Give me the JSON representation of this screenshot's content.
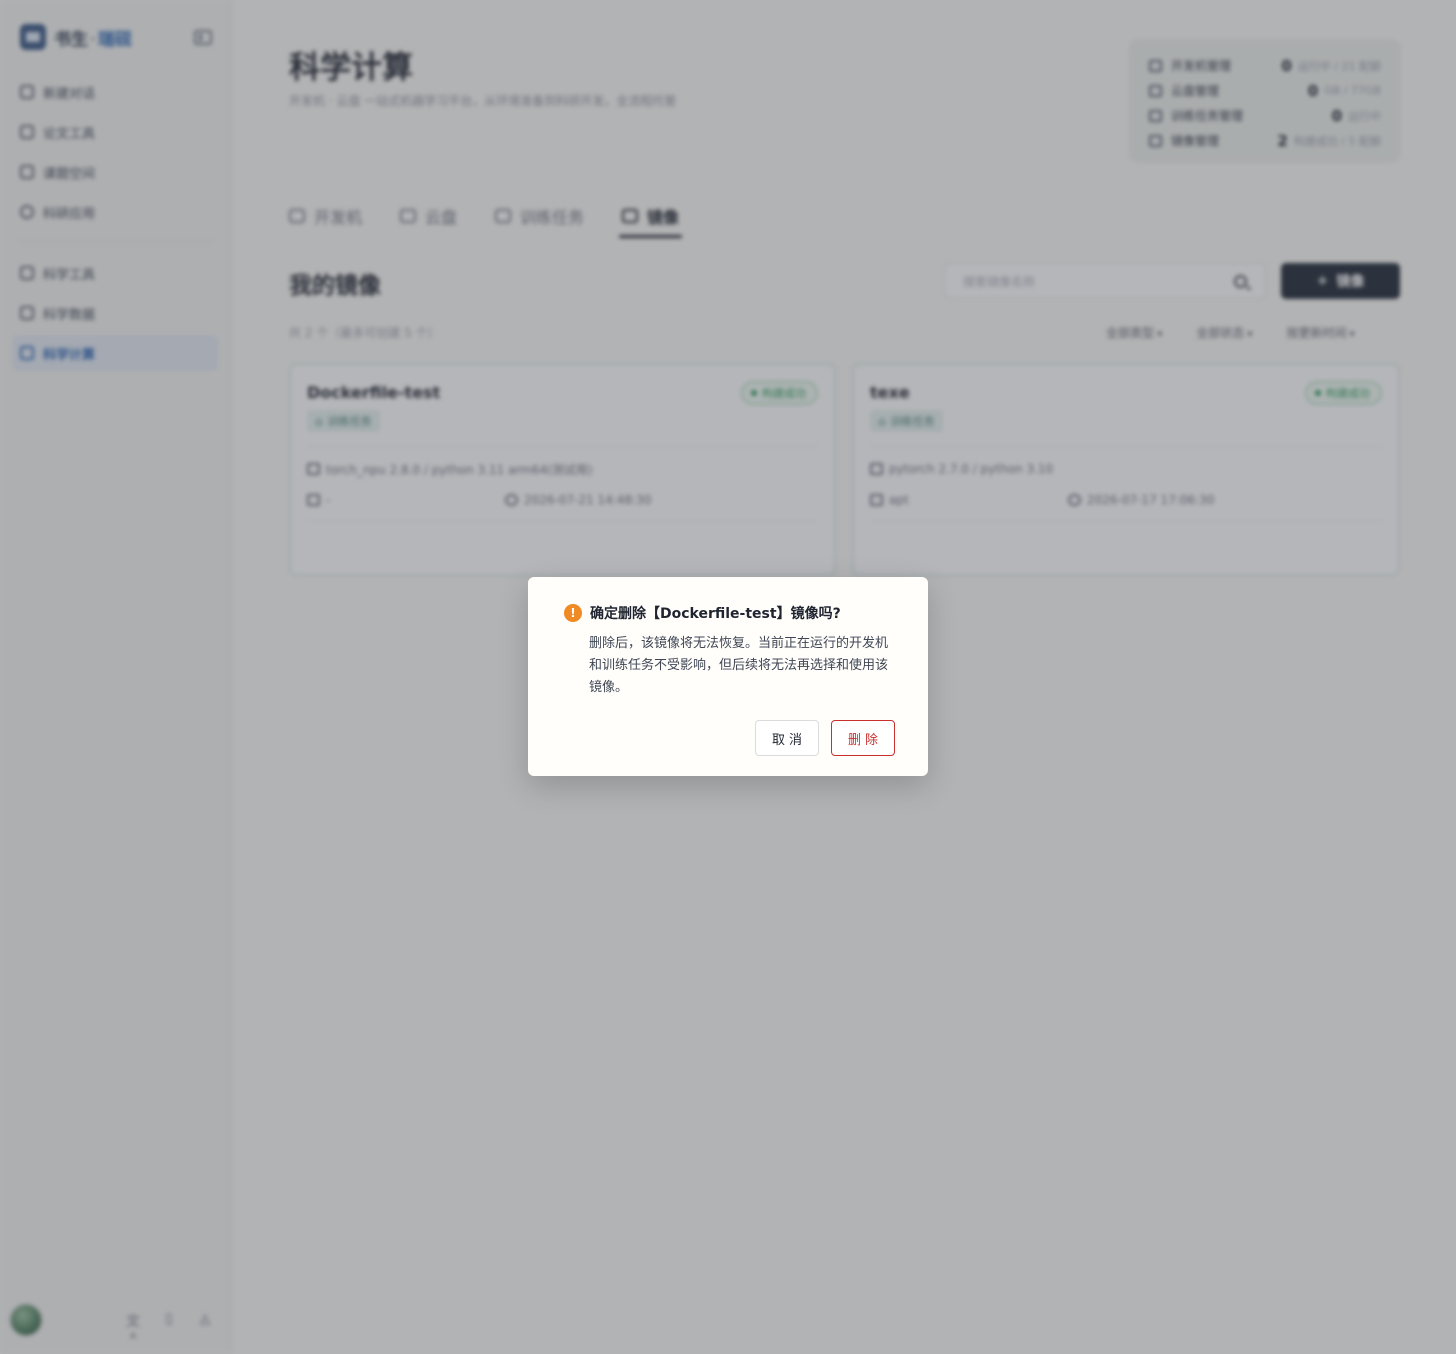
{
  "brand": {
    "name_left": "书生",
    "dot": "·",
    "name_right": "瑞砚"
  },
  "sidebar": {
    "items": [
      {
        "label": "新建对话"
      },
      {
        "label": "论文工具"
      },
      {
        "label": "课题空间"
      },
      {
        "label": "科研应用"
      },
      {
        "label": "科学工具"
      },
      {
        "label": "科学数据"
      },
      {
        "label": "科学计算"
      }
    ],
    "active_index": 6,
    "footer_icons": [
      "translate-icon",
      "document-icon",
      "bell-icon"
    ],
    "footer_glyphs": {
      "translate": "文ᴬ",
      "doc": "▯",
      "bell": "◬"
    }
  },
  "page": {
    "title": "科学计算",
    "subtitle": "开发机 · 云盘 一站式机器学习平台，从环境准备到科研开发，全流程托管"
  },
  "stats": [
    {
      "label": "开发机管理",
      "num": "0",
      "desc": "运行中 / 21 配额"
    },
    {
      "label": "云盘管理",
      "num": "0",
      "desc": "GB / 77GB"
    },
    {
      "label": "训练任务管理",
      "num": "0",
      "desc": "运行中"
    },
    {
      "label": "镜像管理",
      "num": "2",
      "desc": "构建成功 / 5 配额"
    }
  ],
  "tabs": [
    {
      "label": "开发机"
    },
    {
      "label": "云盘"
    },
    {
      "label": "训练任务"
    },
    {
      "label": "镜像"
    }
  ],
  "section": {
    "title": "我的镜像",
    "search_placeholder": "搜索镜像名称",
    "new_button": "镜像",
    "new_button_glyph": "+",
    "count_text": "共 2 个（最多可创建 5 个）",
    "filters": [
      "全部类型",
      "全部状态",
      "按更新时间"
    ]
  },
  "cards": [
    {
      "name": "Dockerfile-test",
      "status": "构建成功",
      "tag": "训练任务",
      "env": "torch_npu 2.8.0 / python 3.11 arm64(测试用)",
      "extra": "-",
      "time": "2026-07-21 14:48:30"
    },
    {
      "name": "texe",
      "status": "构建成功",
      "tag": "训练任务",
      "env": "pytorch 2.7.0 / python 3.10",
      "extra": "apt",
      "time": "2026-07-17 17:06:30"
    }
  ],
  "modal": {
    "icon": "!",
    "title": "确定删除【Dockerfile-test】镜像吗?",
    "body": "删除后，该镜像将无法恢复。当前正在运行的开发机和训练任务不受影响，但后续将无法再选择和使用该镜像。",
    "cancel_label": "取消",
    "delete_label": "删除"
  },
  "colors": {
    "accent": "#2e67b5",
    "primary_button": "#222a38",
    "danger": "#c9302c",
    "warning": "#f08a24",
    "success": "#2a9a58"
  }
}
